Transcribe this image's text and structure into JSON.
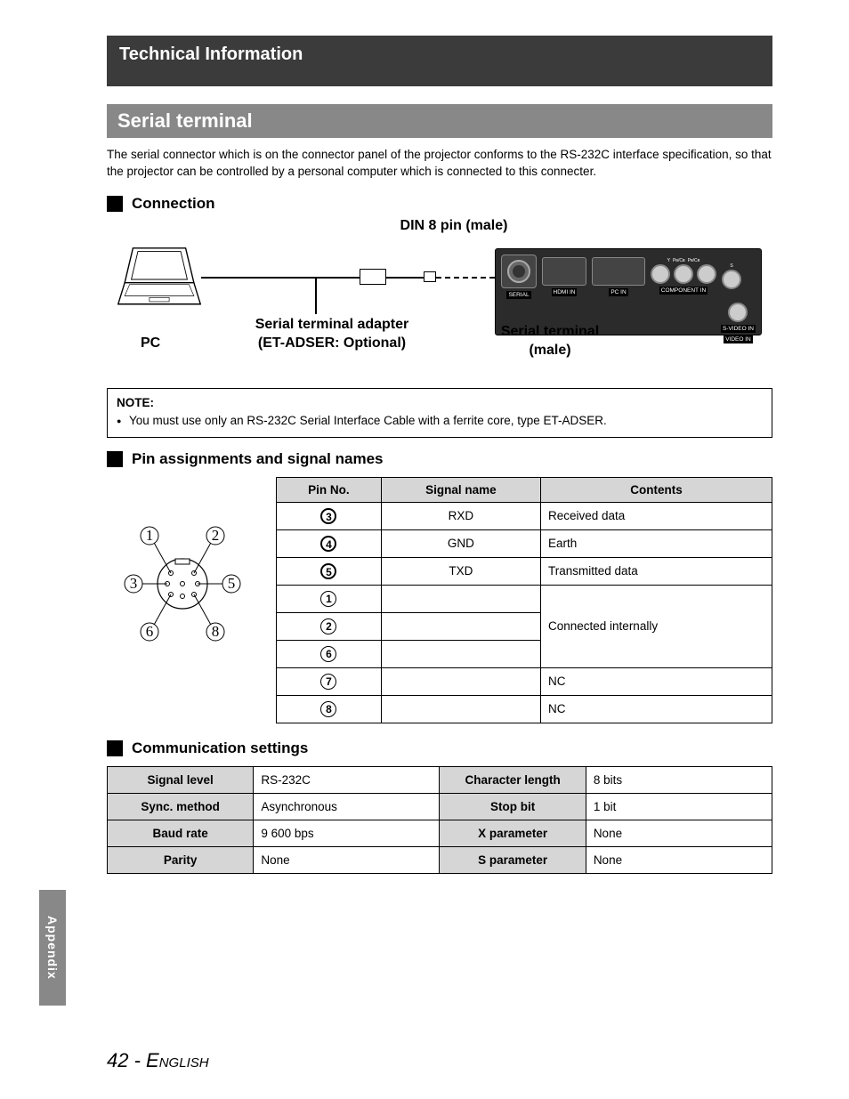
{
  "header": {
    "title": "Technical Information"
  },
  "section": {
    "title": "Serial terminal"
  },
  "intro": "The serial connector which is on the connector panel of the projector conforms to the RS-232C interface specification, so that the projector can be controlled by a personal computer which is connected to this connecter.",
  "sub_connection": "Connection",
  "diagram": {
    "din_label": "DIN 8 pin (male)",
    "pc_label": "PC",
    "adapter_label_l1": "Serial terminal adapter",
    "adapter_label_l2": "(ET-ADSER: Optional)",
    "serial_term_l1": "Serial terminal",
    "serial_term_l2": "(male)",
    "ports": {
      "serial": "SERIAL",
      "hdmi": "HDMI IN",
      "pcin": "PC IN",
      "component": "COMPONENT IN",
      "svideo": "S-VIDEO IN",
      "video": "VIDEO IN",
      "y": "Y",
      "pb": "Pʙ/Cʙ",
      "pr": "Pʀ/Cʀ",
      "s": "S"
    }
  },
  "note": {
    "title": "NOTE:",
    "item": "You must use only an RS-232C Serial Interface Cable with a ferrite core, type ET-ADSER."
  },
  "sub_pins": "Pin assignments and signal names",
  "pin_table": {
    "headers": {
      "pin": "Pin No.",
      "signal": "Signal name",
      "contents": "Contents"
    },
    "rows": [
      {
        "pin": "3",
        "signal": "RXD",
        "contents": "Received data"
      },
      {
        "pin": "4",
        "signal": "GND",
        "contents": "Earth"
      },
      {
        "pin": "5",
        "signal": "TXD",
        "contents": "Transmitted data"
      },
      {
        "pin": "1",
        "signal": "",
        "contents": "Connected internally"
      },
      {
        "pin": "2",
        "signal": "",
        "contents": ""
      },
      {
        "pin": "6",
        "signal": "",
        "contents": ""
      },
      {
        "pin": "7",
        "signal": "",
        "contents": "NC"
      },
      {
        "pin": "8",
        "signal": "",
        "contents": "NC"
      }
    ]
  },
  "pin_diagram_labels": [
    "1",
    "2",
    "3",
    "5",
    "6",
    "8"
  ],
  "sub_comm": "Communication settings",
  "comm_table": [
    {
      "label1": "Signal level",
      "val1": "RS-232C",
      "label2": "Character length",
      "val2": "8 bits"
    },
    {
      "label1": "Sync. method",
      "val1": "Asynchronous",
      "label2": "Stop bit",
      "val2": "1 bit"
    },
    {
      "label1": "Baud rate",
      "val1": "9 600 bps",
      "label2": "X parameter",
      "val2": "None"
    },
    {
      "label1": "Parity",
      "val1": "None",
      "label2": "S parameter",
      "val2": "None"
    }
  ],
  "appendix_tab": "Appendix",
  "footer": {
    "page": "42",
    "sep": " - ",
    "lang": "English"
  }
}
